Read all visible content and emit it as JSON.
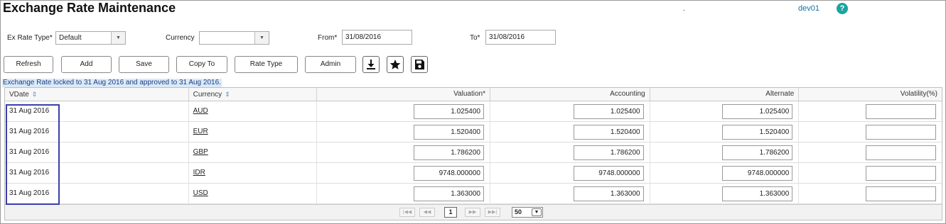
{
  "header": {
    "title": "Exchange Rate Maintenance",
    "dot": ".",
    "user": "dev01",
    "help_icon": "?"
  },
  "filters": {
    "ex_rate_type_label": "Ex Rate Type*",
    "ex_rate_type_value": "Default",
    "currency_label": "Currency",
    "currency_value": "",
    "from_label": "From*",
    "from_value": "31/08/2016",
    "to_label": "To*",
    "to_value": "31/08/2016"
  },
  "toolbar": {
    "refresh": "Refresh",
    "add": "Add",
    "save": "Save",
    "copy_to": "Copy To",
    "rate_type": "Rate Type",
    "admin": "Admin",
    "icons": [
      "download-icon",
      "star-icon",
      "floppy-disk-icon"
    ]
  },
  "status_message": "Exchange Rate locked to 31 Aug 2016 and approved to 31 Aug 2016.",
  "table": {
    "columns": [
      "VDate",
      "Currency",
      "Valuation*",
      "Accounting",
      "Alternate",
      "Volatility(%)"
    ],
    "rows": [
      {
        "vdate": "31 Aug 2016",
        "currency": "AUD",
        "valuation": "1.025400",
        "accounting": "1.025400",
        "alternate": "1.025400",
        "volatility": ""
      },
      {
        "vdate": "31 Aug 2016",
        "currency": "EUR",
        "valuation": "1.520400",
        "accounting": "1.520400",
        "alternate": "1.520400",
        "volatility": ""
      },
      {
        "vdate": "31 Aug 2016",
        "currency": "GBP",
        "valuation": "1.786200",
        "accounting": "1.786200",
        "alternate": "1.786200",
        "volatility": ""
      },
      {
        "vdate": "31 Aug 2016",
        "currency": "IDR",
        "valuation": "9748.000000",
        "accounting": "9748.000000",
        "alternate": "9748.000000",
        "volatility": ""
      },
      {
        "vdate": "31 Aug 2016",
        "currency": "USD",
        "valuation": "1.363000",
        "accounting": "1.363000",
        "alternate": "1.363000",
        "volatility": ""
      }
    ]
  },
  "pager": {
    "first": "|◀◀",
    "prev": "◀◀",
    "page": "1",
    "next": "▶▶",
    "last": "▶▶|",
    "page_size": "50"
  },
  "colors": {
    "accent": "#1a6fa0",
    "help": "#1aa5a0",
    "status_bg": "#dbeaf6",
    "highlight_border": "#3b3faa"
  }
}
